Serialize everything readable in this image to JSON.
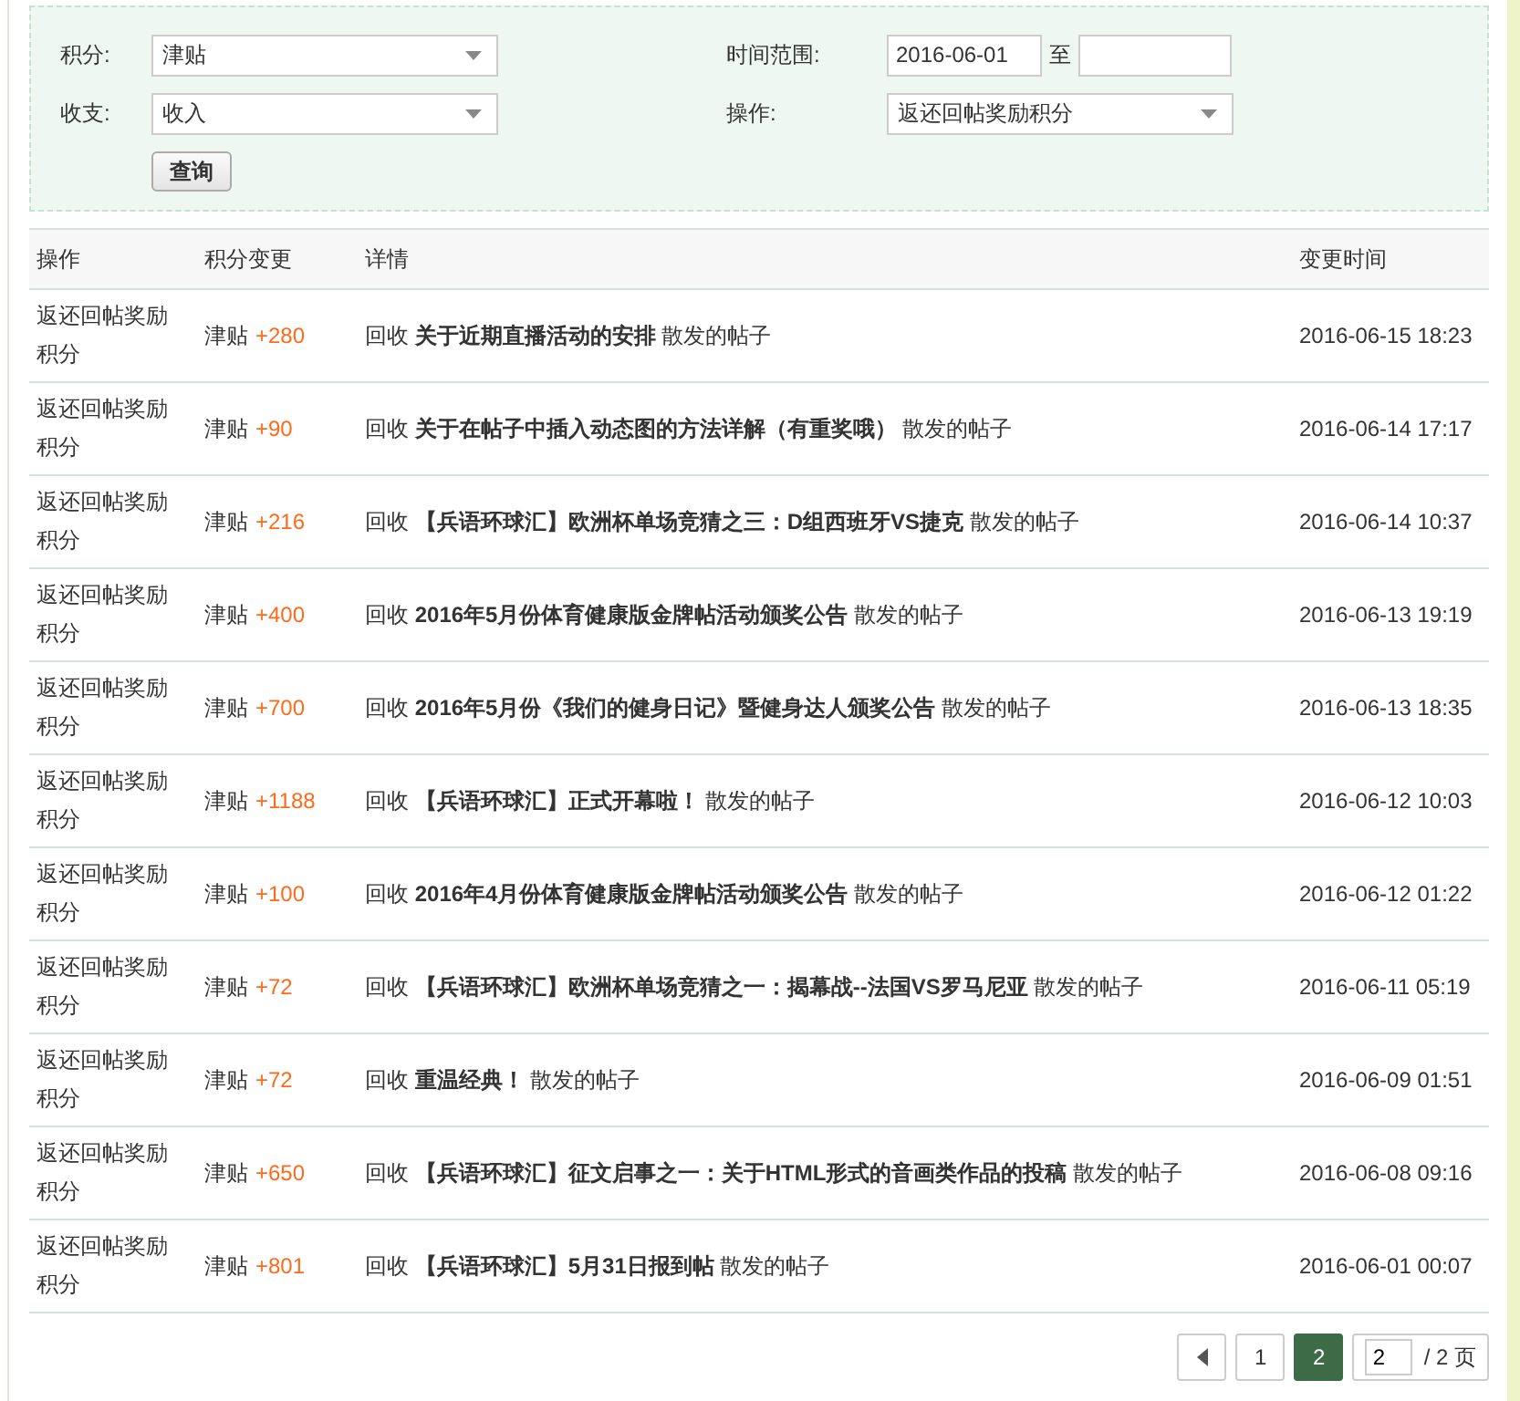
{
  "filters": [
    {
      "kind": "select",
      "label": "积分:",
      "value": "津贴"
    },
    {
      "kind": "range",
      "label": "时间范围:",
      "from": "2016-06-01",
      "separator": "至"
    },
    {
      "kind": "select",
      "label": "收支:",
      "value": "收入"
    },
    {
      "kind": "select",
      "label": "操作:",
      "value": "返还回帖奖励积分"
    }
  ],
  "query_button": "查询",
  "table": {
    "columns": [
      "操作",
      "积分变更",
      "详情",
      "变更时间"
    ],
    "rows": [
      {
        "operation": "返还回帖奖励积分",
        "currency": "津贴",
        "amount": "+280",
        "detail": "回收 **关于近期直播活动的安排** 散发的帖子",
        "time": "2016-06-15 18:23"
      },
      {
        "operation": "返还回帖奖励积分",
        "currency": "津贴",
        "amount": "+90",
        "detail": "回收 **关于在帖子中插入动态图的方法详解（有重奖哦）** 散发的帖子",
        "time": "2016-06-14 17:17"
      },
      {
        "operation": "返还回帖奖励积分",
        "currency": "津贴",
        "amount": "+216",
        "detail": "回收 **【兵语环球汇】欧洲杯单场竞猜之三：D组西班牙VS捷克** 散发的帖子",
        "time": "2016-06-14 10:37"
      },
      {
        "operation": "返还回帖奖励积分",
        "currency": "津贴",
        "amount": "+400",
        "detail": "回收 **2016年5月份体育健康版金牌帖活动颁奖公告** 散发的帖子",
        "time": "2016-06-13 19:19"
      },
      {
        "operation": "返还回帖奖励积分",
        "currency": "津贴",
        "amount": "+700",
        "detail": "回收 **2016年5月份《我们的健身日记》暨健身达人颁奖公告** 散发的帖子",
        "time": "2016-06-13 18:35"
      },
      {
        "operation": "返还回帖奖励积分",
        "currency": "津贴",
        "amount": "+1188",
        "detail": "回收 **【兵语环球汇】正式开幕啦！** 散发的帖子",
        "time": "2016-06-12 10:03"
      },
      {
        "operation": "返还回帖奖励积分",
        "currency": "津贴",
        "amount": "+100",
        "detail": "回收 **2016年4月份体育健康版金牌帖活动颁奖公告** 散发的帖子",
        "time": "2016-06-12 01:22"
      },
      {
        "operation": "返还回帖奖励积分",
        "currency": "津贴",
        "amount": "+72",
        "detail": "回收 **【兵语环球汇】欧洲杯单场竞猜之一：揭幕战--法国VS罗马尼亚** 散发的帖子",
        "time": "2016-06-11 05:19"
      },
      {
        "operation": "返还回帖奖励积分",
        "currency": "津贴",
        "amount": "+72",
        "detail": "回收 **重温经典！** 散发的帖子",
        "time": "2016-06-09 01:51"
      },
      {
        "operation": "返还回帖奖励积分",
        "currency": "津贴",
        "amount": "+650",
        "detail": "回收 **【兵语环球汇】征文启事之一：关于HTML形式的音画类作品的投稿** 散发的帖子",
        "time": "2016-06-08 09:16"
      },
      {
        "operation": "返还回帖奖励积分",
        "currency": "津贴",
        "amount": "+801",
        "detail": "回收 **【兵语环球汇】5月31日报到帖** 散发的帖子",
        "time": "2016-06-01 00:07"
      }
    ]
  },
  "pagination": {
    "pages": [
      {
        "label": "1",
        "selected": false
      },
      {
        "label": "2",
        "selected": true
      }
    ],
    "page_input": "2",
    "total": "/ 2 页"
  }
}
